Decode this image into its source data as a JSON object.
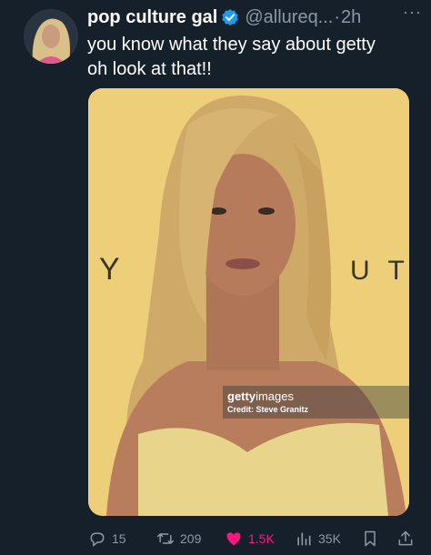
{
  "tweet": {
    "display_name": "pop culture gal",
    "handle": "@allureq...",
    "separator": "·",
    "time": "2h",
    "more": "···",
    "text_line1": "you know what they say about getty",
    "text_line2": "oh look at that!!"
  },
  "media": {
    "backdrop_left": "Y",
    "backdrop_right": "U T Y",
    "watermark_brand_bold": "getty",
    "watermark_brand_rest": "images",
    "watermark_credit": "Credit: Steve Granitz"
  },
  "actions": {
    "replies": "15",
    "reposts": "209",
    "likes": "1.5K",
    "views": "35K"
  },
  "colors": {
    "background": "#15202b",
    "secondary_text": "#8b98a5",
    "verified": "#1d9bf0",
    "like": "#f91880",
    "photo_backdrop": "#eccf78"
  },
  "icons": [
    "verified-badge-icon",
    "more-icon",
    "reply-icon",
    "repost-icon",
    "like-icon",
    "views-icon",
    "bookmark-icon",
    "share-icon"
  ]
}
